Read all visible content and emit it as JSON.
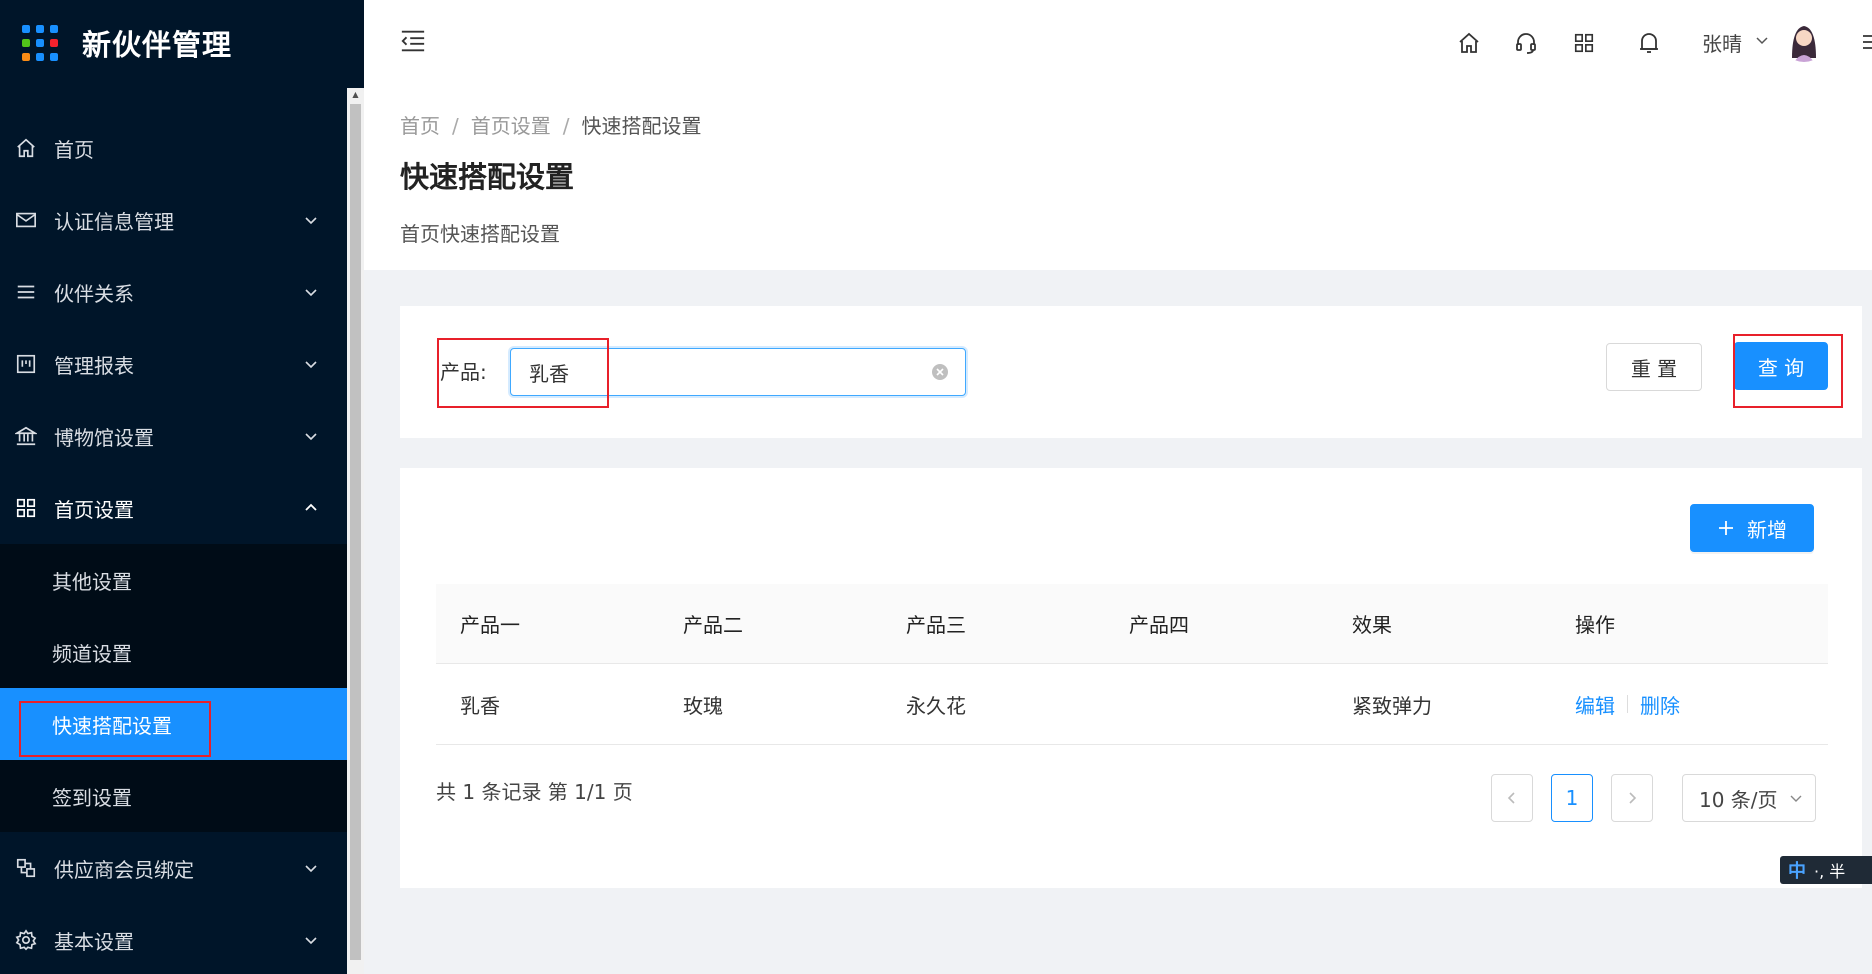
{
  "app": {
    "title": "新伙伴管理",
    "logo_colors": [
      "#1890ff",
      "#1890ff",
      "#1890ff",
      "#52c41a",
      "#1890ff",
      "#f5222d",
      "#fa8c16",
      "#1890ff",
      "#1890ff"
    ]
  },
  "sidebar": {
    "items": [
      {
        "label": "首页",
        "icon": "home-icon",
        "expandable": false
      },
      {
        "label": "认证信息管理",
        "icon": "mail-icon",
        "expandable": true
      },
      {
        "label": "伙伴关系",
        "icon": "menu-icon",
        "expandable": true
      },
      {
        "label": "管理报表",
        "icon": "report-icon",
        "expandable": true
      },
      {
        "label": "博物馆设置",
        "icon": "bank-icon",
        "expandable": true
      },
      {
        "label": "首页设置",
        "icon": "appstore-icon",
        "expandable": true,
        "expanded": true
      },
      {
        "label": "供应商会员绑定",
        "icon": "link-icon",
        "expandable": true
      },
      {
        "label": "基本设置",
        "icon": "setting-icon",
        "expandable": true
      }
    ],
    "submenu": [
      {
        "label": "其他设置"
      },
      {
        "label": "频道设置"
      },
      {
        "label": "快速搭配设置",
        "active": true
      },
      {
        "label": "签到设置"
      }
    ]
  },
  "header": {
    "user_name": "张晴",
    "icons": [
      "menu-fold-icon",
      "home-icon",
      "customer-service-icon",
      "apps-icon",
      "bell-icon"
    ]
  },
  "page": {
    "breadcrumb": [
      "首页",
      "首页设置",
      "快速搭配设置"
    ],
    "title": "快速搭配设置",
    "description": "首页快速搭配设置"
  },
  "search": {
    "product_label": "产品:",
    "product_value": "乳香",
    "reset_label": "重 置",
    "query_label": "查 询"
  },
  "table": {
    "add_label": "新增",
    "columns": [
      "产品一",
      "产品二",
      "产品三",
      "产品四",
      "效果",
      "操作"
    ],
    "rows": [
      {
        "p1": "乳香",
        "p2": "玫瑰",
        "p3": "永久花",
        "p4": "",
        "effect": "紧致弹力",
        "edit": "编辑",
        "delete": "删除"
      }
    ]
  },
  "pagination": {
    "total_text": "共 1 条记录 第 1/1 页",
    "current_page": "1",
    "page_size": "10 条/页"
  },
  "ime": {
    "lang": "中",
    "rest": "·, 半"
  },
  "colors": {
    "sidebar_bg": "#001529",
    "primary": "#1890ff",
    "highlight_box": "#e8202a"
  }
}
